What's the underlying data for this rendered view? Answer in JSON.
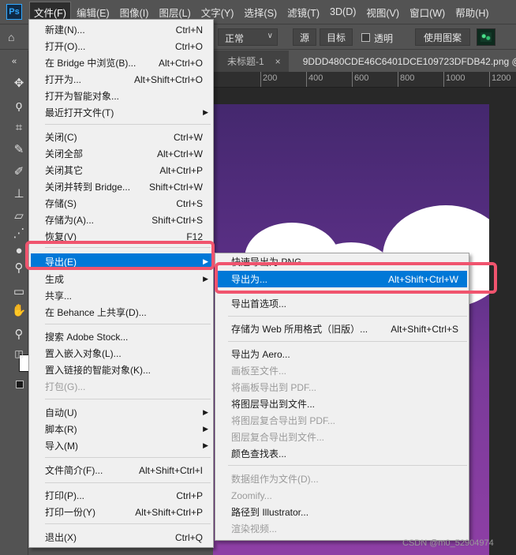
{
  "menubar": {
    "logo": "Ps",
    "items": [
      "文件(F)",
      "编辑(E)",
      "图像(I)",
      "图层(L)",
      "文字(Y)",
      "选择(S)",
      "滤镜(T)",
      "3D(D)",
      "视图(V)",
      "窗口(W)",
      "帮助(H)"
    ]
  },
  "options_bar": {
    "blend_mode": "正常",
    "source_btn": "源",
    "target_btn": "目标",
    "transparent_label": "透明",
    "use_pattern_btn": "使用图案"
  },
  "tabs": [
    {
      "label": "未标题-1",
      "close": "×"
    },
    {
      "label": "9DDD480CDE46C6401DCE109723DFDB42.png @",
      "close": ""
    }
  ],
  "ruler": {
    "ticks": [
      "200",
      "400",
      "600",
      "800",
      "1000",
      "1200"
    ]
  },
  "file_menu": {
    "items": [
      {
        "label": "新建(N)...",
        "shortcut": "Ctrl+N"
      },
      {
        "label": "打开(O)...",
        "shortcut": "Ctrl+O"
      },
      {
        "label": "在 Bridge 中浏览(B)...",
        "shortcut": "Alt+Ctrl+O"
      },
      {
        "label": "打开为...",
        "shortcut": "Alt+Shift+Ctrl+O"
      },
      {
        "label": "打开为智能对象...",
        "shortcut": ""
      },
      {
        "label": "最近打开文件(T)",
        "shortcut": ""
      },
      {
        "label": "关闭(C)",
        "shortcut": "Ctrl+W"
      },
      {
        "label": "关闭全部",
        "shortcut": "Alt+Ctrl+W"
      },
      {
        "label": "关闭其它",
        "shortcut": "Alt+Ctrl+P"
      },
      {
        "label": "关闭并转到 Bridge...",
        "shortcut": "Shift+Ctrl+W"
      },
      {
        "label": "存储(S)",
        "shortcut": "Ctrl+S"
      },
      {
        "label": "存储为(A)...",
        "shortcut": "Shift+Ctrl+S"
      },
      {
        "label": "恢复(V)",
        "shortcut": "F12"
      },
      {
        "label": "导出(E)",
        "shortcut": ""
      },
      {
        "label": "生成",
        "shortcut": ""
      },
      {
        "label": "共享...",
        "shortcut": ""
      },
      {
        "label": "在 Behance 上共享(D)...",
        "shortcut": ""
      },
      {
        "label": "搜索 Adobe Stock...",
        "shortcut": ""
      },
      {
        "label": "置入嵌入对象(L)...",
        "shortcut": ""
      },
      {
        "label": "置入链接的智能对象(K)...",
        "shortcut": ""
      },
      {
        "label": "打包(G)...",
        "shortcut": ""
      },
      {
        "label": "自动(U)",
        "shortcut": ""
      },
      {
        "label": "脚本(R)",
        "shortcut": ""
      },
      {
        "label": "导入(M)",
        "shortcut": ""
      },
      {
        "label": "文件简介(F)...",
        "shortcut": "Alt+Shift+Ctrl+I"
      },
      {
        "label": "打印(P)...",
        "shortcut": "Ctrl+P"
      },
      {
        "label": "打印一份(Y)",
        "shortcut": "Alt+Shift+Ctrl+P"
      },
      {
        "label": "退出(X)",
        "shortcut": "Ctrl+Q"
      }
    ]
  },
  "export_menu": {
    "items": [
      {
        "label": "快速导出为 PNG",
        "shortcut": ""
      },
      {
        "label": "导出为...",
        "shortcut": "Alt+Shift+Ctrl+W"
      },
      {
        "label": "导出首选项...",
        "shortcut": ""
      },
      {
        "label": "存储为 Web 所用格式（旧版）...",
        "shortcut": "Alt+Shift+Ctrl+S"
      },
      {
        "label": "导出为 Aero...",
        "shortcut": ""
      },
      {
        "label": "画板至文件...",
        "shortcut": ""
      },
      {
        "label": "将画板导出到 PDF...",
        "shortcut": ""
      },
      {
        "label": "将图层导出到文件...",
        "shortcut": ""
      },
      {
        "label": "将图层复合导出到 PDF...",
        "shortcut": ""
      },
      {
        "label": "图层复合导出到文件...",
        "shortcut": ""
      },
      {
        "label": "颜色查找表...",
        "shortcut": ""
      },
      {
        "label": "数据组作为文件(D)...",
        "shortcut": ""
      },
      {
        "label": "Zoomify...",
        "shortcut": ""
      },
      {
        "label": "路径到 Illustrator...",
        "shortcut": ""
      },
      {
        "label": "渲染视频...",
        "shortcut": ""
      }
    ]
  },
  "watermark": "CSDN @m0_52904974",
  "colors": {
    "highlight": "#0078d7",
    "annotation": "#f0546e",
    "menu_bg": "#f0f0f0"
  }
}
